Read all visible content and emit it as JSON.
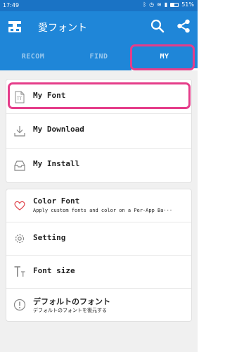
{
  "status_bar": {
    "time": "17:49",
    "battery_percent": "51%"
  },
  "app_bar": {
    "title": "愛フォント"
  },
  "tabs": [
    {
      "label": "RECOM",
      "selected": false
    },
    {
      "label": "FIND",
      "selected": false
    },
    {
      "label": "MY",
      "selected": true
    }
  ],
  "section1": [
    {
      "label": "My Font",
      "icon": "font-file-icon"
    },
    {
      "label": "My Download",
      "icon": "download-icon"
    },
    {
      "label": "My Install",
      "icon": "install-tray-icon"
    }
  ],
  "section2": [
    {
      "label": "Color Font",
      "sub": "Apply custom fonts and color on a Per-App Ba···",
      "icon": "heart-icon"
    },
    {
      "label": "Setting",
      "icon": "gear-icon"
    },
    {
      "label": "Font size",
      "icon": "font-size-icon"
    },
    {
      "label": "デフォルトのフォント",
      "sub": "デフォルトのフォントを復元する",
      "icon": "info-icon"
    }
  ],
  "colors": {
    "app_bar": "#1f86d8",
    "status_bar": "#1a73c5",
    "highlight": "#e53d8a",
    "background": "#f0f0f0"
  }
}
